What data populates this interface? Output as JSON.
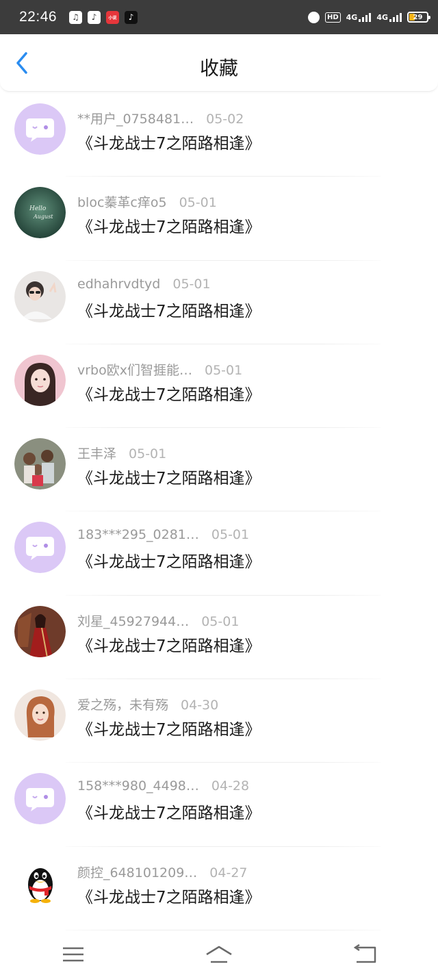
{
  "status_bar": {
    "time": "22:46",
    "app_icons": [
      "music-icon",
      "note-icon",
      "news-icon",
      "tiktok-icon"
    ],
    "app_icon_glyphs": [
      "♫",
      "♪",
      "小说",
      "♪"
    ],
    "hd_label": "HD",
    "network_1": "4G",
    "network_2": "4G",
    "battery": "29",
    "battery_level": 0.29
  },
  "header": {
    "title": "收藏",
    "back_icon": "chevron-left-icon",
    "accent": "#2a8cf0"
  },
  "items": [
    {
      "user": "**用户_0758481…",
      "date": "05-02",
      "title": "《斗龙战士7之陌路相逢》",
      "avatar": "default-chat"
    },
    {
      "user": "bloc蓁革c痒o5",
      "date": "05-01",
      "title": "《斗龙战士7之陌路相逢》",
      "avatar": "photo-green"
    },
    {
      "user": "edhahrvdtyd",
      "date": "05-01",
      "title": "《斗龙战士7之陌路相逢》",
      "avatar": "photo-girl-glasses"
    },
    {
      "user": "vrbo欧x们智捱能…",
      "date": "05-01",
      "title": "《斗龙战士7之陌路相逢》",
      "avatar": "photo-girl-pink"
    },
    {
      "user": "王丰泽",
      "date": "05-01",
      "title": "《斗龙战士7之陌路相逢》",
      "avatar": "photo-kids"
    },
    {
      "user": "183***295_0281…",
      "date": "05-01",
      "title": "《斗龙战士7之陌路相逢》",
      "avatar": "default-chat"
    },
    {
      "user": "刘星_45927944…",
      "date": "05-01",
      "title": "《斗龙战士7之陌路相逢》",
      "avatar": "photo-red-dress"
    },
    {
      "user": "爱之殇，未有殇",
      "date": "04-30",
      "title": "《斗龙战士7之陌路相逢》",
      "avatar": "photo-woman"
    },
    {
      "user": "158***980_4498…",
      "date": "04-28",
      "title": "《斗龙战士7之陌路相逢》",
      "avatar": "default-chat"
    },
    {
      "user": "颜控_648101209…",
      "date": "04-27",
      "title": "《斗龙战士7之陌路相逢》",
      "avatar": "qq-penguin"
    }
  ],
  "bottom_nav": {
    "menu_icon": "menu-icon",
    "home_icon": "home-icon",
    "back_icon": "back-icon"
  },
  "colors": {
    "status_bar_bg": "#3c3c3c",
    "default_avatar_bg": "#d9c6f5",
    "username_color": "#9a9a9a",
    "title_color": "#1c1c1c"
  }
}
